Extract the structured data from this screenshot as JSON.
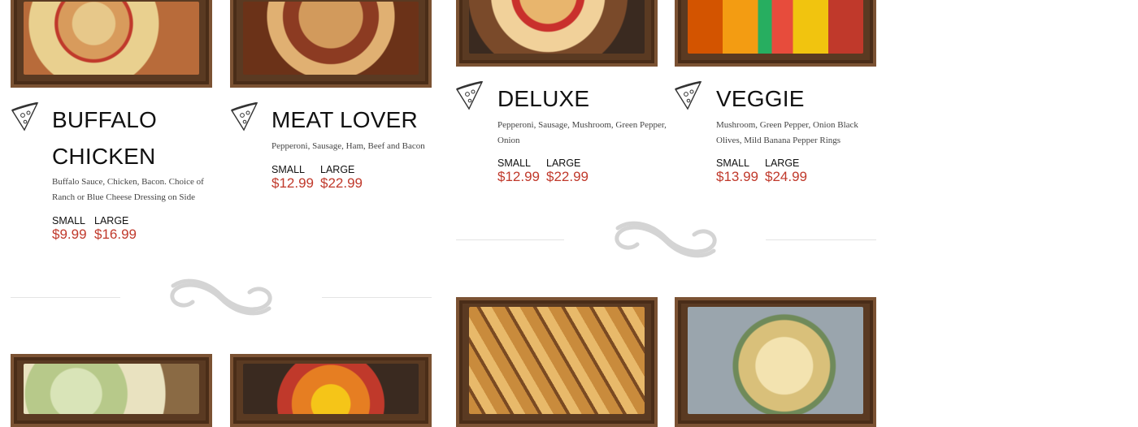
{
  "menu": {
    "items": [
      {
        "name": "BUFFALO CHICKEN",
        "name_line1": "BUFFALO",
        "name_line2": "CHICKEN",
        "description": "Buffalo Sauce, Chicken, Bacon. Choice of Ranch or Blue Cheese Dressing on Side",
        "small_label": "SMALL",
        "small_price": "$9.99",
        "large_label": "LARGE",
        "large_price": "$16.99"
      },
      {
        "name": "MEAT LOVER",
        "description": "Pepperoni, Sausage, Ham, Beef and Bacon",
        "small_label": "SMALL",
        "small_price": "$12.99",
        "large_label": "LARGE",
        "large_price": "$22.99"
      },
      {
        "name": "DELUXE",
        "description_line1": "Pepperoni, Sausage, Mushroom, Green Pepper,",
        "description_line2": "Onion",
        "small_label": "SMALL",
        "small_price": "$12.99",
        "large_label": "LARGE",
        "large_price": "$22.99"
      },
      {
        "name": "VEGGIE",
        "description_line1": "Mushroom, Green Pepper, Onion Black",
        "description_line2": "Olives, Mild Banana Pepper Rings",
        "small_label": "SMALL",
        "small_price": "$13.99",
        "large_label": "LARGE",
        "large_price": "$24.99"
      }
    ],
    "icons": {
      "slice": "pizza-slice-icon",
      "divider": "swirl-divider-icon"
    },
    "colors": {
      "price": "#c0392b",
      "frame": "#5a3a22"
    }
  }
}
